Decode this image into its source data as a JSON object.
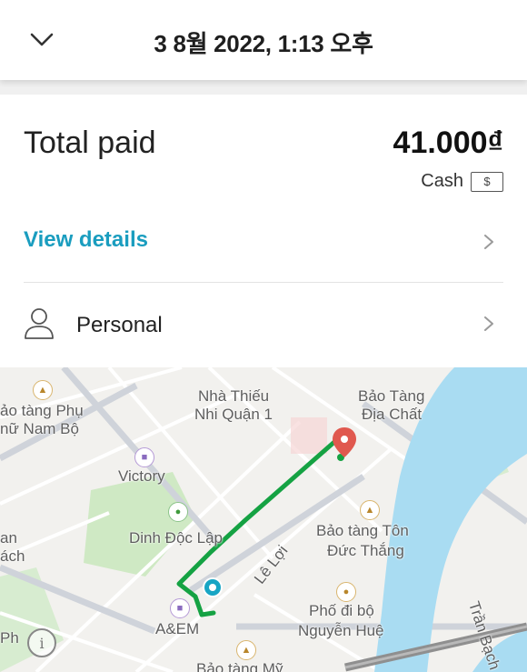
{
  "header": {
    "title": "3 8월 2022, 1:13 오후",
    "back_icon": "chevron-down-icon"
  },
  "payment": {
    "total_label": "Total paid",
    "total_amount": "41.000₫",
    "method_label": "Cash",
    "method_icon_glyph": "$"
  },
  "details": {
    "label": "View details",
    "accent": "#1a9dbf"
  },
  "profile": {
    "label": "Personal"
  },
  "map": {
    "labels": {
      "nha_thieu_1": "Nhà Thiếu",
      "nha_thieu_2": "Nhi Quận 1",
      "bao_tang_dia_chat_1": "Bảo Tàng",
      "bao_tang_dia_chat_2": "Địa Chất",
      "bao_tang_phu_1": "ảo tàng Phụ",
      "bao_tang_phu_2": "nữ Nam Bộ",
      "victory": "Victory",
      "dinh_doc_lap": "Dinh Độc Lập",
      "bao_tang_ton_1": "Bảo tàng Tôn",
      "bao_tang_ton_2": "Đức Thắng",
      "le_loi": "Lê Lợi",
      "pho_di_bo_1": "Phố đi bộ",
      "pho_di_bo_2": "Nguyễn Huệ",
      "aem": "A&EM",
      "bao_tang_my": "Bảo tàng Mỹ",
      "tran_bach": "Trần Bạch",
      "left_an": "an",
      "left_ach": "ách",
      "left_ph": "Ph"
    },
    "route_color": "#15a243",
    "water_color": "#a9dcf2",
    "park_color": "#cfe9c4"
  }
}
